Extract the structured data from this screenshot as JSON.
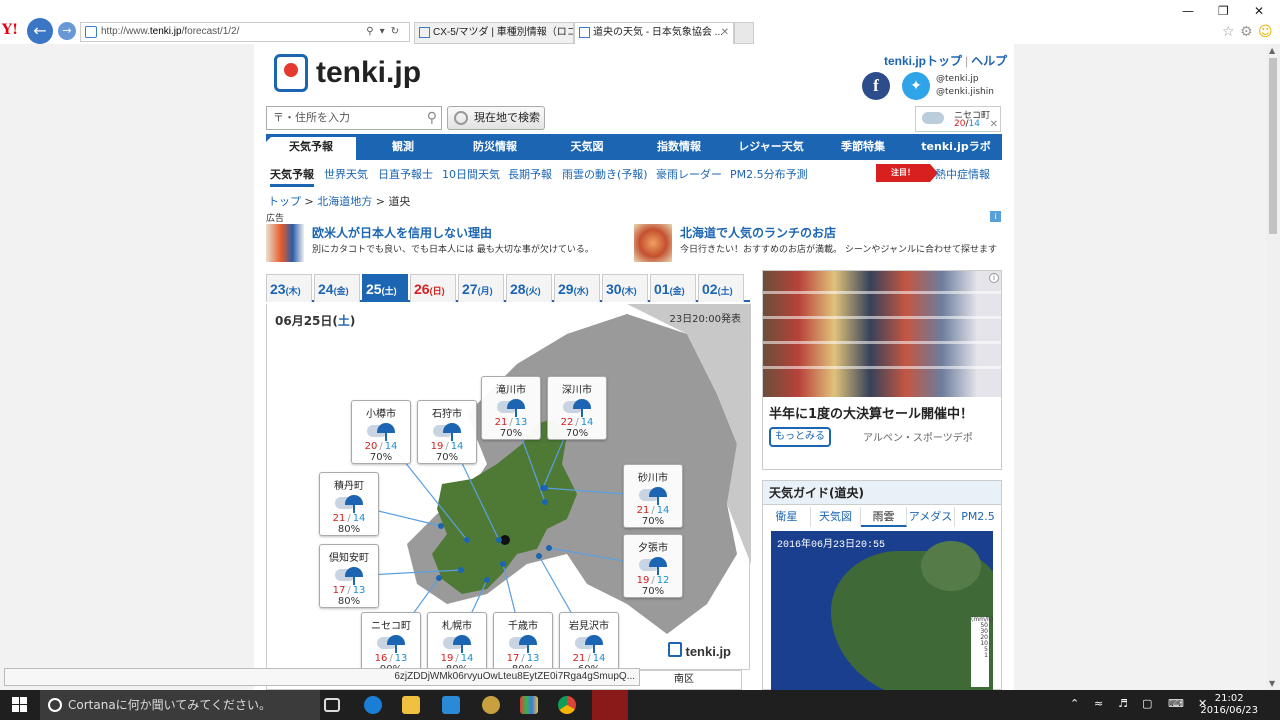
{
  "browser": {
    "url_prefix": "http://www.",
    "url_host": "tenki.jp",
    "url_path": "/forecast/1/2/",
    "tabs": [
      {
        "label": "CX-5/マツダ | 車種別情報（ロコ..."
      },
      {
        "label": "道央の天気 - 日本気象協会 ..."
      }
    ]
  },
  "site": {
    "logo": "tenki.jp",
    "top_link": "tenki.jpトップ",
    "help_link": "ヘルプ",
    "twitter_1": "@tenki.jp",
    "twitter_2": "@tenki.jishin",
    "search_placeholder": "〒・住所を入力",
    "locate_button": "現在地で検索",
    "mini": {
      "place": "ニセコ町",
      "high": "20",
      "low": "14"
    }
  },
  "nav": [
    "天気予報",
    "観測",
    "防災情報",
    "天気図",
    "指数情報",
    "レジャー天気",
    "季節特集",
    "tenki.jpラボ"
  ],
  "subnav": [
    "天気予報",
    "世界天気",
    "日直予報士",
    "10日間天気",
    "長期予報",
    "雨雲の動き(予報)",
    "豪雨レーダー",
    "PM2.5分布予測"
  ],
  "alert": {
    "badge": "注目！",
    "link": "熱中症情報"
  },
  "breadcrumb": {
    "top": "トップ",
    "region": "北海道地方",
    "current": "道央"
  },
  "ads": {
    "label": "広告",
    "a1_title": "欧米人が日本人を信用しない理由",
    "a1_desc": "別にカタコトでも良い、でも日本人には 最も大切な事が欠けている。",
    "a2_title": "北海道で人気のランチのお店",
    "a2_desc": "今日行きたい！おすすめのお店が満載。 シーンやジャンルに合わせて探せます"
  },
  "dates": [
    {
      "d": "23",
      "w": "(木)",
      "k": "wk"
    },
    {
      "d": "24",
      "w": "(金)",
      "k": "wk"
    },
    {
      "d": "25",
      "w": "(土)",
      "k": "on"
    },
    {
      "d": "26",
      "w": "(日)",
      "k": "sun"
    },
    {
      "d": "27",
      "w": "(月)",
      "k": "wk"
    },
    {
      "d": "28",
      "w": "(火)",
      "k": "wk"
    },
    {
      "d": "29",
      "w": "(水)",
      "k": "wk"
    },
    {
      "d": "30",
      "w": "(木)",
      "k": "wk"
    },
    {
      "d": "01",
      "w": "(金)",
      "k": "wk"
    },
    {
      "d": "02",
      "w": "(土)",
      "k": "wk"
    }
  ],
  "map": {
    "date": "06月25日(",
    "date_wd": "土",
    "date_end": ")",
    "announced": "23日20:00発表",
    "logo": "tenki.jp",
    "cities": [
      {
        "name": "滝川市",
        "hi": "21",
        "lo": "13",
        "pop": "70%"
      },
      {
        "name": "深川市",
        "hi": "22",
        "lo": "14",
        "pop": "70%"
      },
      {
        "name": "小樽市",
        "hi": "20",
        "lo": "14",
        "pop": "70%"
      },
      {
        "name": "石狩市",
        "hi": "19",
        "lo": "14",
        "pop": "70%"
      },
      {
        "name": "砂川市",
        "hi": "21",
        "lo": "14",
        "pop": "70%"
      },
      {
        "name": "積丹町",
        "hi": "21",
        "lo": "14",
        "pop": "80%"
      },
      {
        "name": "夕張市",
        "hi": "19",
        "lo": "12",
        "pop": "70%"
      },
      {
        "name": "倶知安町",
        "hi": "17",
        "lo": "13",
        "pop": "80%"
      },
      {
        "name": "ニセコ町",
        "hi": "16",
        "lo": "13",
        "pop": "90%"
      },
      {
        "name": "札幌市",
        "hi": "19",
        "lo": "14",
        "pop": "80%"
      },
      {
        "name": "千歳市",
        "hi": "17",
        "lo": "13",
        "pop": "80%"
      },
      {
        "name": "岩見沢市",
        "hi": "21",
        "lo": "14",
        "pop": "60%"
      }
    ],
    "bottom_label": "南区"
  },
  "ad2": {
    "title": "半年に1度の大決算セール開催中！",
    "button": "もっとみる",
    "sponsor": "アルペン・スポーツデポ"
  },
  "guide": {
    "title": "天気ガイド(道央)",
    "tabs": [
      "衛星",
      "天気図",
      "雨雲",
      "アメダス",
      "PM2.5"
    ],
    "radar_time": "2016年06月23日20:55",
    "legend_unit": "(mm/h)",
    "legend": [
      "50",
      "30",
      "20",
      "10",
      "5",
      "1"
    ]
  },
  "status_url": "6zjZDDjWMk06rvyuOwLteu8EytZE0i7Rga4gSmupQ...",
  "taskbar": {
    "cortana": "Cortanaに何か聞いてみてください。",
    "time": "21:02",
    "date": "2016/06/23"
  }
}
